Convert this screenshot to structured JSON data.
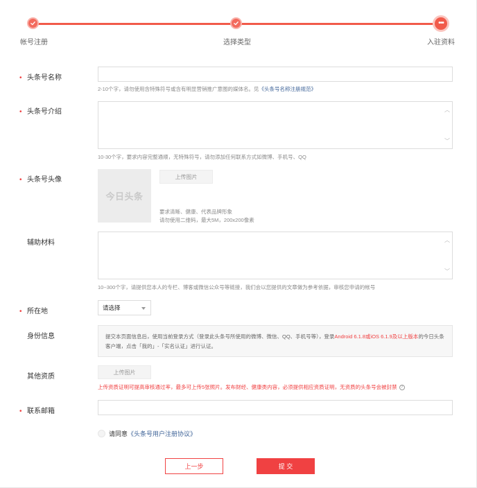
{
  "stepper": {
    "steps": [
      {
        "label": "帐号注册",
        "state": "done"
      },
      {
        "label": "选择类型",
        "state": "done"
      },
      {
        "label": "入驻资料",
        "state": "current",
        "icon_text": "•••"
      }
    ]
  },
  "form": {
    "name": {
      "label": "头条号名称",
      "required": "•",
      "value": "",
      "hint_prefix": "2-10个字，请勿使用含特殊符号或含有明显营销推广意图的媒体名。见",
      "hint_link": "《头条号名称注册规范》"
    },
    "intro": {
      "label": "头条号介绍",
      "required": "•",
      "value": "",
      "hint": "10-30个字，要求内容完整通顺，无特殊符号，请勿添加任何联系方式如微博、手机号、QQ"
    },
    "avatar": {
      "label": "头条号头像",
      "required": "•",
      "placeholder_text": "今日头条",
      "upload_label": "上传图片",
      "req_line1": "要求清晰、健康、代表品牌形象",
      "req_line2": "请勿使用二维码，最大5M，200x200像素"
    },
    "materials": {
      "label": "辅助材料",
      "value": "",
      "hint": "10~300个字，请提供您本人的专栏、博客或微信公众号等链接，我们会以您提供的文章做为参考依据，审核您申请的帐号"
    },
    "location": {
      "label": "所在地",
      "required": "•",
      "selected": "请选择"
    },
    "identity": {
      "label": "身份信息",
      "text_part1": "提交本页面信息后，使用当前登录方式（登录此头条号所使用的微博、微信、QQ、手机号等），登录",
      "text_red": "Android 6.1.8或iOS 6.1.9及以上版本",
      "text_part2": "的今日头条客户端，点击「我的」-「实名认证」进行认证。"
    },
    "qualification": {
      "label": "其他资质",
      "upload_label": "上传图片",
      "note": "上传资质证明可提高审核通过率，最多可上传5张照片。发布财经、健康类内容，必须提供相应资质证明，无资质的头条号会被封禁",
      "help": "?"
    },
    "email": {
      "label": "联系邮箱",
      "required": "•",
      "value": ""
    },
    "agreement": {
      "text": "请同意",
      "link": "《头条号用户注册协议》"
    }
  },
  "buttons": {
    "prev": "上一步",
    "submit": "提 交"
  },
  "colors": {
    "accent": "#f04142",
    "link": "#406599"
  }
}
